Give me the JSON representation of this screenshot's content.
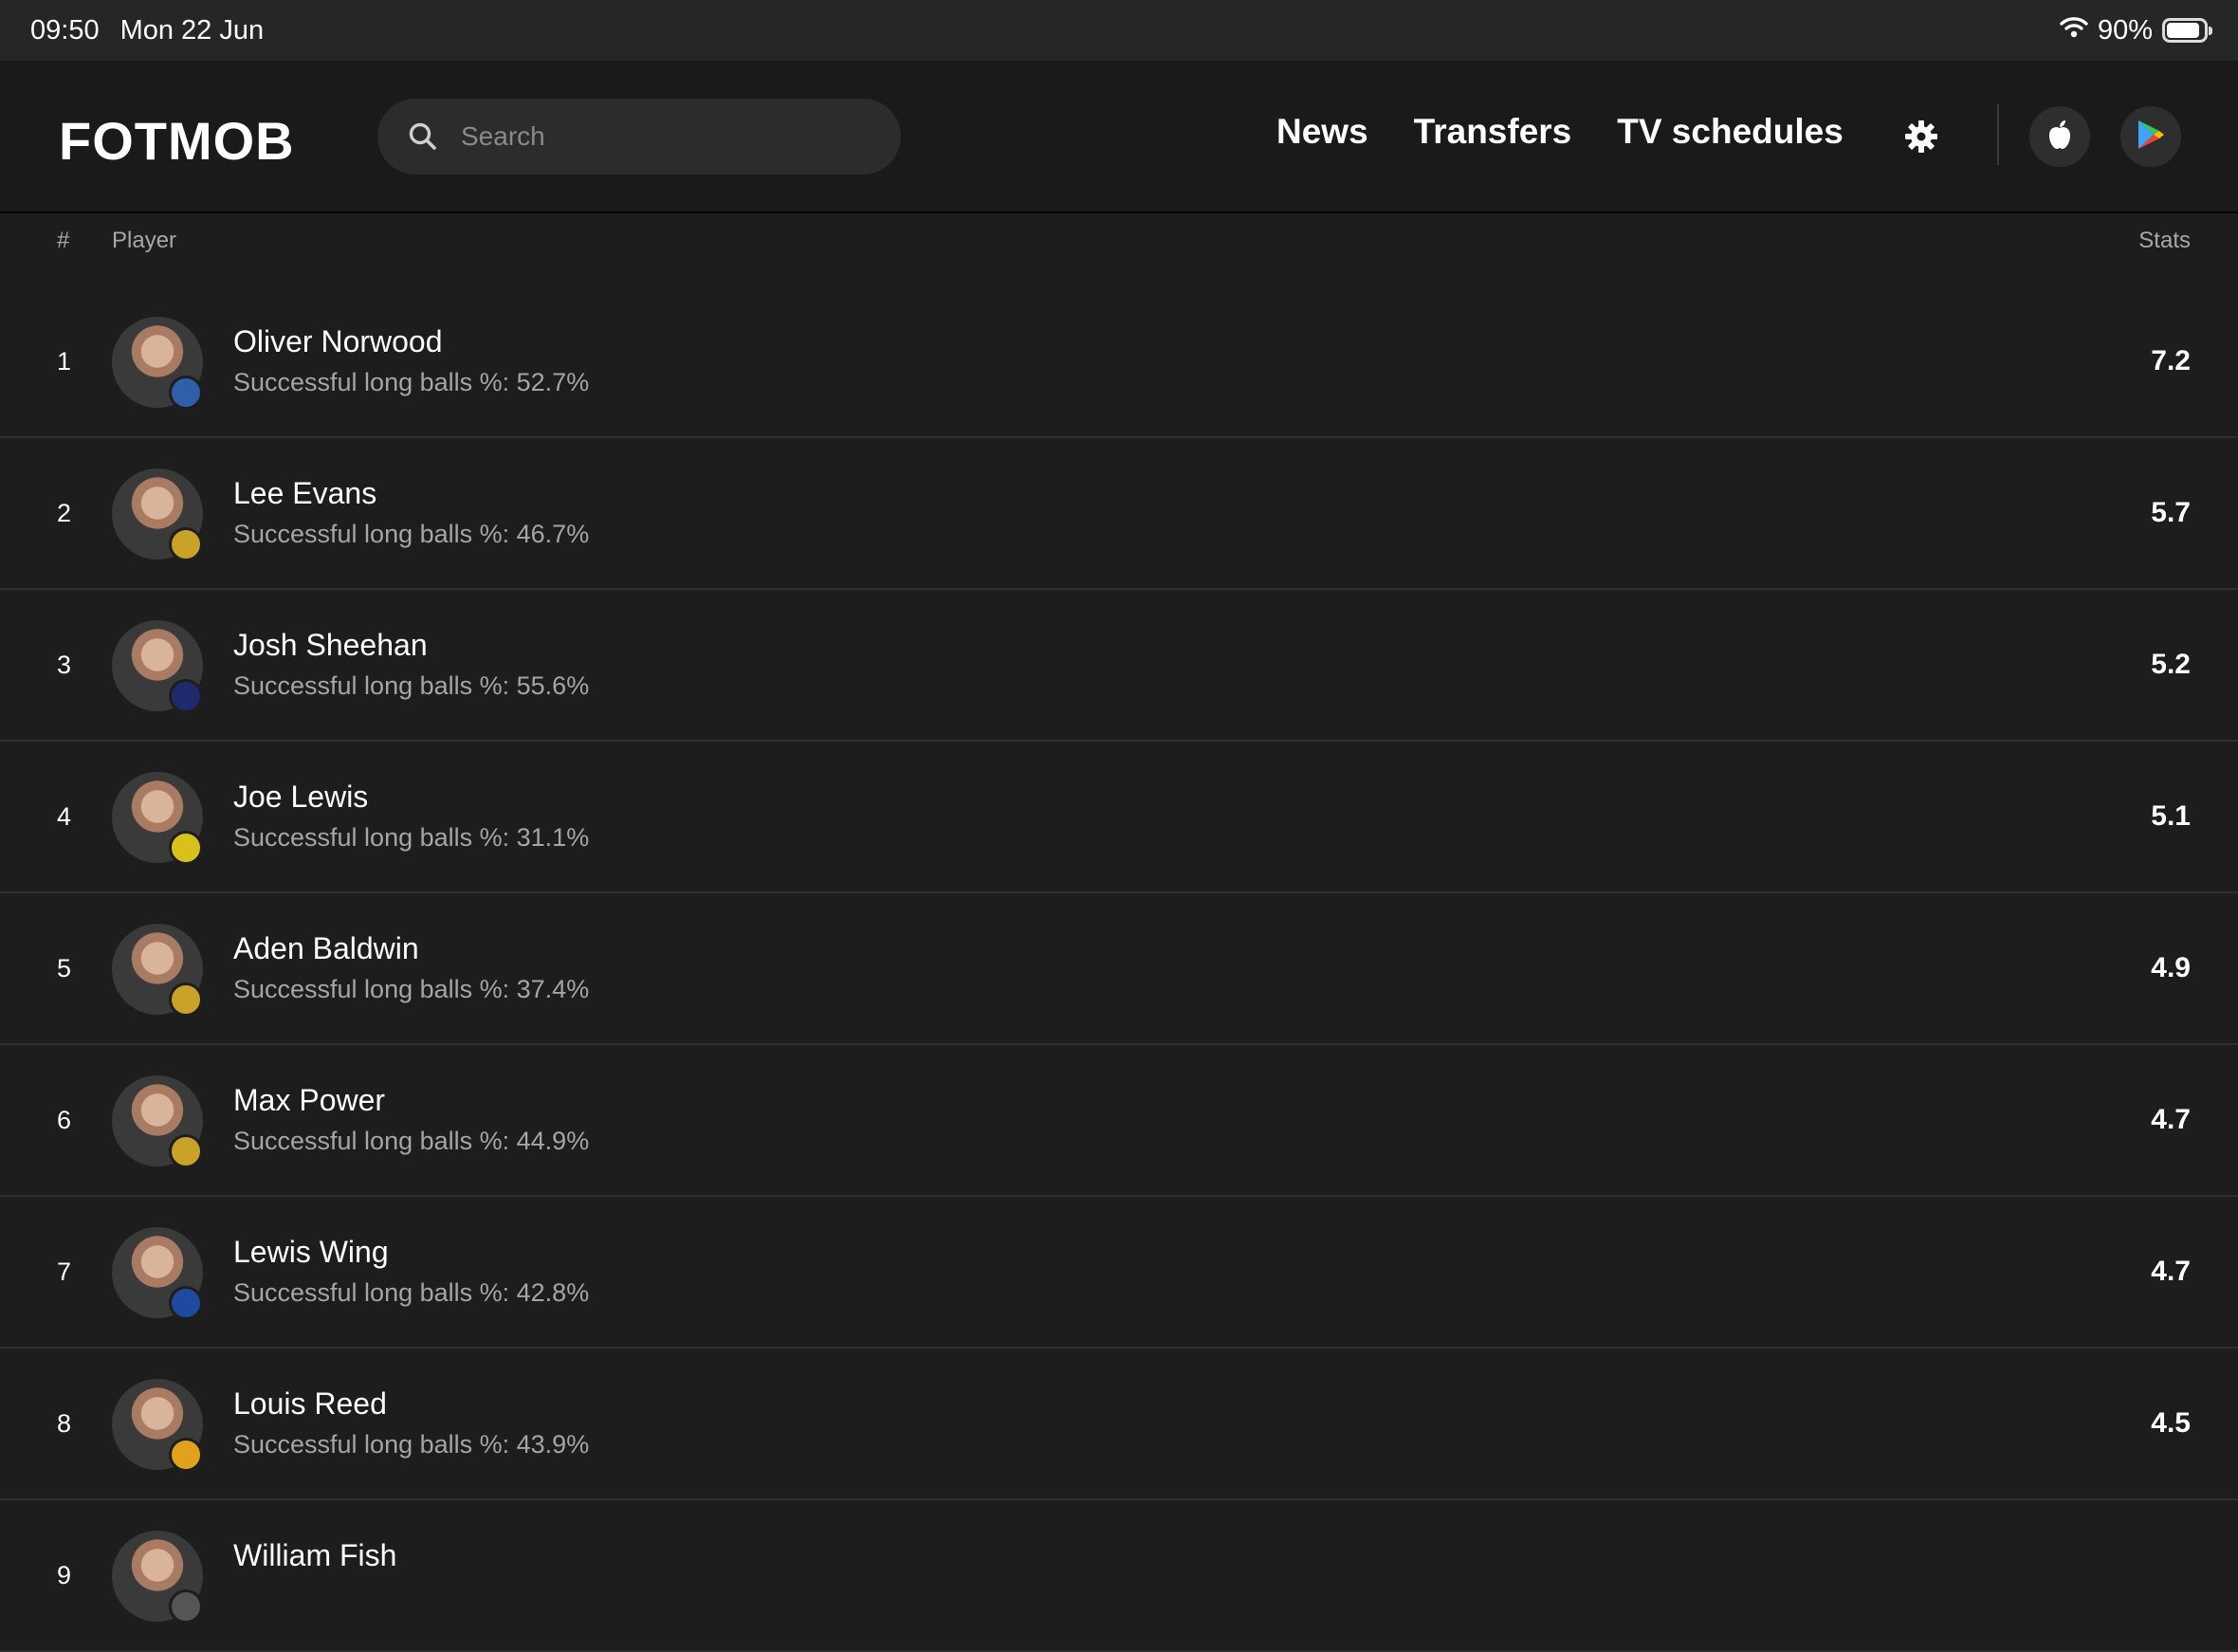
{
  "status_bar": {
    "time": "09:50",
    "date": "Mon 22 Jun",
    "battery": "90%",
    "battery_level": 0.9
  },
  "header": {
    "logo": "FOTMOB",
    "search_placeholder": "Search",
    "nav": [
      "News",
      "Transfers",
      "TV schedules"
    ]
  },
  "table": {
    "col_rank": "#",
    "col_player": "Player",
    "col_stats": "Stats",
    "rows": [
      {
        "rank": "1",
        "name": "Oliver Norwood",
        "sub": "Successful long balls %: 52.7%",
        "stat": "7.2",
        "badge_color": "#2f5fa8"
      },
      {
        "rank": "2",
        "name": "Lee Evans",
        "sub": "Successful long balls %: 46.7%",
        "stat": "5.7",
        "badge_color": "#c9a227"
      },
      {
        "rank": "3",
        "name": "Josh Sheehan",
        "sub": "Successful long balls %: 55.6%",
        "stat": "5.2",
        "badge_color": "#1e2a6b"
      },
      {
        "rank": "4",
        "name": "Joe Lewis",
        "sub": "Successful long balls %: 31.1%",
        "stat": "5.1",
        "badge_color": "#d8c21a"
      },
      {
        "rank": "5",
        "name": "Aden Baldwin",
        "sub": "Successful long balls %: 37.4%",
        "stat": "4.9",
        "badge_color": "#c9a227"
      },
      {
        "rank": "6",
        "name": "Max Power",
        "sub": "Successful long balls %: 44.9%",
        "stat": "4.7",
        "badge_color": "#c9a227"
      },
      {
        "rank": "7",
        "name": "Lewis Wing",
        "sub": "Successful long balls %: 42.8%",
        "stat": "4.7",
        "badge_color": "#1e4aa0"
      },
      {
        "rank": "8",
        "name": "Louis Reed",
        "sub": "Successful long balls %: 43.9%",
        "stat": "4.5",
        "badge_color": "#e0a21a"
      },
      {
        "rank": "9",
        "name": "William Fish",
        "sub": "",
        "stat": "",
        "badge_color": "#555555"
      }
    ]
  }
}
